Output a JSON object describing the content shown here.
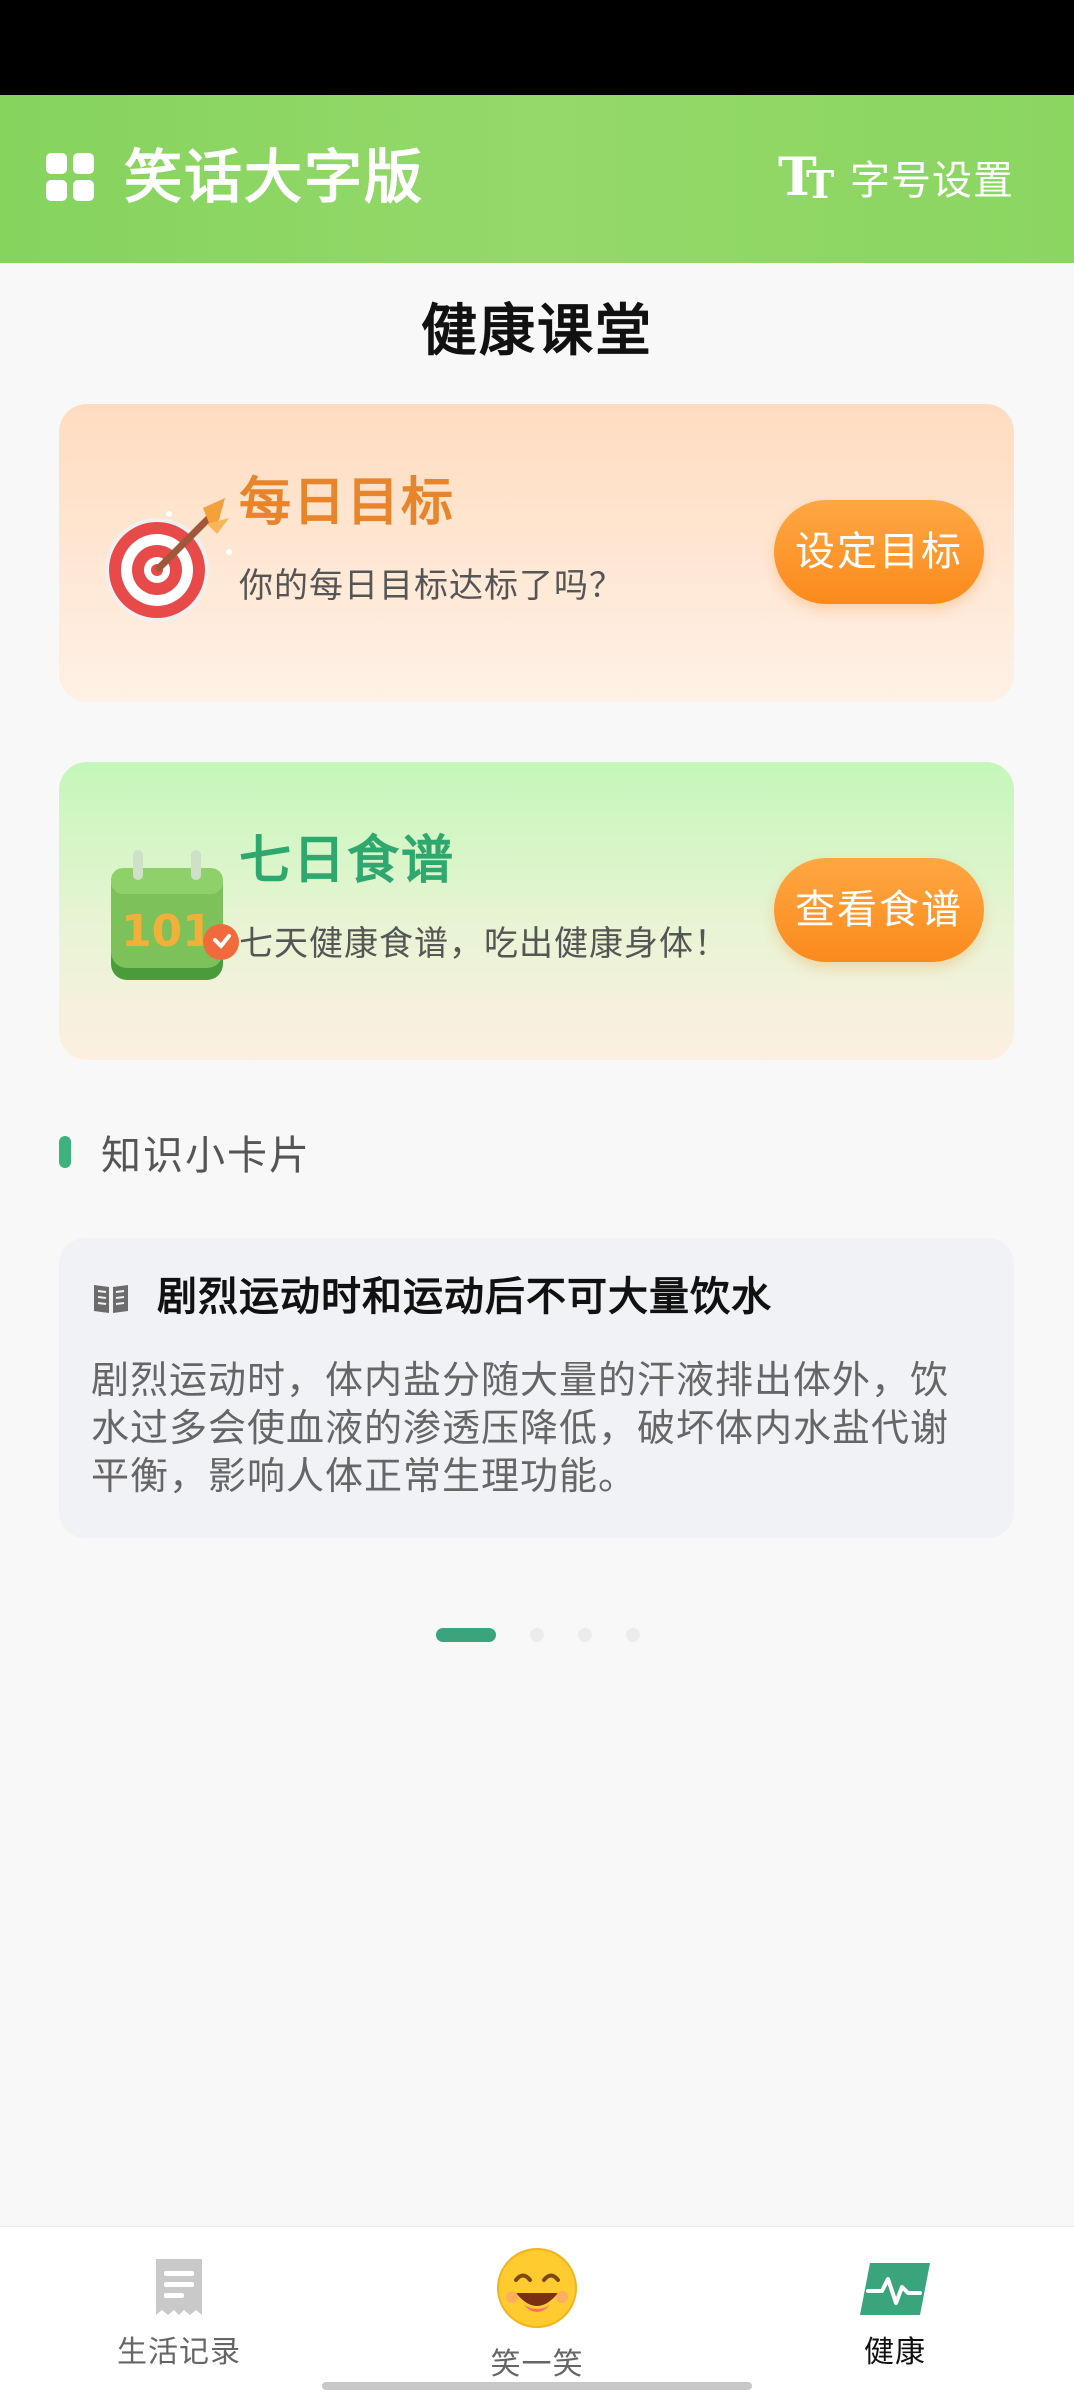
{
  "header": {
    "title": "笑话大字版",
    "font_setting_label": "字号设置",
    "menu_icon": "grid-menu-icon",
    "font_icon": "font-size-icon"
  },
  "page": {
    "title": "健康课堂"
  },
  "cards": {
    "goal": {
      "title": "每日目标",
      "subtitle": "你的每日目标达标了吗？",
      "button": "设定目标",
      "icon": "target-icon"
    },
    "recipe": {
      "title": "七日食谱",
      "subtitle": "七天健康食谱，吃出健康身体！",
      "button": "查看食谱",
      "icon": "calendar-icon"
    }
  },
  "knowledge": {
    "section_label": "知识小卡片",
    "title": "剧烈运动时和运动后不可大量饮水",
    "body": "剧烈运动时，体内盐分随大量的汗液排出体外，饮水过多会使血液的渗透压降低，破坏体内水盐代谢平衡，影响人体正常生理功能。",
    "page_index": 1,
    "page_count": 4
  },
  "bottom_nav": {
    "items": [
      {
        "label": "生活记录",
        "icon": "receipt-icon",
        "active": false
      },
      {
        "label": "笑一笑",
        "icon": "laughing-face-icon",
        "active": false
      },
      {
        "label": "健康",
        "icon": "health-pulse-icon",
        "active": true
      }
    ]
  },
  "colors": {
    "header_green": "#8bd561",
    "accent_orange": "#fb8a1c",
    "accent_green": "#3aa57c",
    "goal_title": "#e8852a",
    "recipe_title": "#2fa86f"
  }
}
